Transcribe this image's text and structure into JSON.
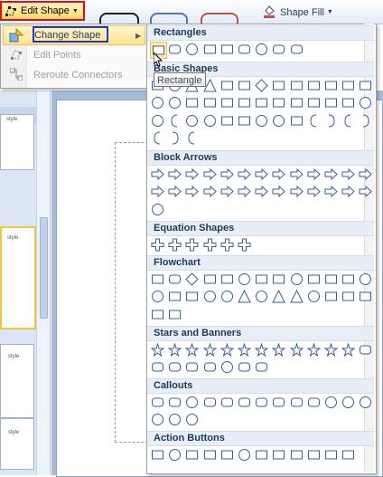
{
  "ribbon": {
    "edit_shape_label": "Edit Shape",
    "shape_fill_label": "Shape Fill"
  },
  "submenu": {
    "items": [
      {
        "label": "Change Shape",
        "state": "highlighted",
        "has_submenu": true
      },
      {
        "label": "Edit Points",
        "state": "disabled"
      },
      {
        "label": "Reroute Connectors",
        "state": "disabled"
      }
    ]
  },
  "gallery": {
    "categories": [
      {
        "label": "Rectangles",
        "icons": [
          "rectangle",
          "rounded-rectangle",
          "snip-single-corner",
          "snip-same-side",
          "snip-diagonal",
          "snip-round-single",
          "round-single-corner",
          "round-same-side",
          "round-diagonal"
        ]
      },
      {
        "label": "Basic Shapes",
        "icons": [
          "text-box",
          "oval",
          "triangle",
          "right-triangle",
          "parallelogram",
          "trapezoid",
          "diamond",
          "pentagon",
          "hexagon",
          "heptagon",
          "octagon",
          "decagon",
          "dodecagon",
          "pie",
          "chord",
          "teardrop",
          "frame",
          "half-frame",
          "l-shape",
          "diagonal-stripe",
          "cross",
          "plaque",
          "can",
          "cube",
          "bevel",
          "donut",
          "no-symbol",
          "block-arc",
          "folded-corner",
          "smiley-face",
          "heart",
          "lightning-bolt",
          "sun",
          "moon",
          "cloud",
          "arc",
          "double-bracket",
          "double-brace",
          "left-bracket",
          "right-bracket",
          "left-brace",
          "right-brace"
        ]
      },
      {
        "label": "Block Arrows",
        "icons": [
          "right-arrow",
          "left-arrow",
          "up-arrow",
          "down-arrow",
          "left-right-arrow",
          "up-down-arrow",
          "quad-arrow",
          "left-right-up-arrow",
          "bent-arrow",
          "u-turn-arrow",
          "left-up-arrow",
          "bent-up-arrow",
          "curved-right-arrow",
          "curved-left-arrow",
          "curved-up-arrow",
          "curved-down-arrow",
          "striped-right-arrow",
          "notched-right-arrow",
          "pentagon-arrow",
          "chevron-arrow",
          "right-arrow-callout",
          "down-arrow-callout",
          "left-arrow-callout",
          "up-arrow-callout",
          "left-right-arrow-callout",
          "quad-arrow-callout",
          "circular-arrow"
        ]
      },
      {
        "label": "Equation Shapes",
        "icons": [
          "plus",
          "minus",
          "multiply",
          "division",
          "equal",
          "not-equal"
        ]
      },
      {
        "label": "Flowchart",
        "icons": [
          "process",
          "alternate-process",
          "decision",
          "data",
          "predefined-process",
          "internal-storage",
          "document",
          "multidocument",
          "terminator",
          "preparation",
          "manual-input",
          "manual-operation",
          "connector",
          "off-page-connector",
          "card",
          "punched-tape",
          "summing-junction",
          "or",
          "collate",
          "sort",
          "extract",
          "merge",
          "stored-data",
          "delay",
          "sequential-access",
          "magnetic-disk",
          "direct-access",
          "display"
        ]
      },
      {
        "label": "Stars and Banners",
        "icons": [
          "explosion-1",
          "explosion-2",
          "4-point-star",
          "5-point-star",
          "6-point-star",
          "7-point-star",
          "8-point-star",
          "10-point-star",
          "12-point-star",
          "16-point-star",
          "24-point-star",
          "32-point-star",
          "up-ribbon",
          "down-ribbon",
          "curved-up-ribbon",
          "curved-down-ribbon",
          "vertical-scroll",
          "horizontal-scroll",
          "wave",
          "double-wave"
        ]
      },
      {
        "label": "Callouts",
        "icons": [
          "rectangular-callout",
          "rounded-rectangular-callout",
          "oval-callout",
          "cloud-callout",
          "line-callout-1",
          "line-callout-2",
          "line-callout-3",
          "line-callout-1-accent",
          "line-callout-2-accent",
          "line-callout-3-accent",
          "line-callout-1-no-border",
          "line-callout-2-no-border",
          "line-callout-3-no-border",
          "line-callout-1-border-accent",
          "line-callout-2-border-accent",
          "line-callout-3-border-accent"
        ]
      },
      {
        "label": "Action Buttons",
        "icons": [
          "back-previous",
          "forward-next",
          "beginning",
          "end",
          "home",
          "information",
          "return",
          "movie",
          "document",
          "sound",
          "help",
          "custom"
        ]
      }
    ],
    "tooltip": "Rectangle"
  },
  "slides": {
    "thumb_label": "style"
  },
  "colors": {
    "highlight_border": "#e01010",
    "focus_border": "#1a3ad8",
    "category_bg": "#e8eef7",
    "text": "#1e395b"
  }
}
